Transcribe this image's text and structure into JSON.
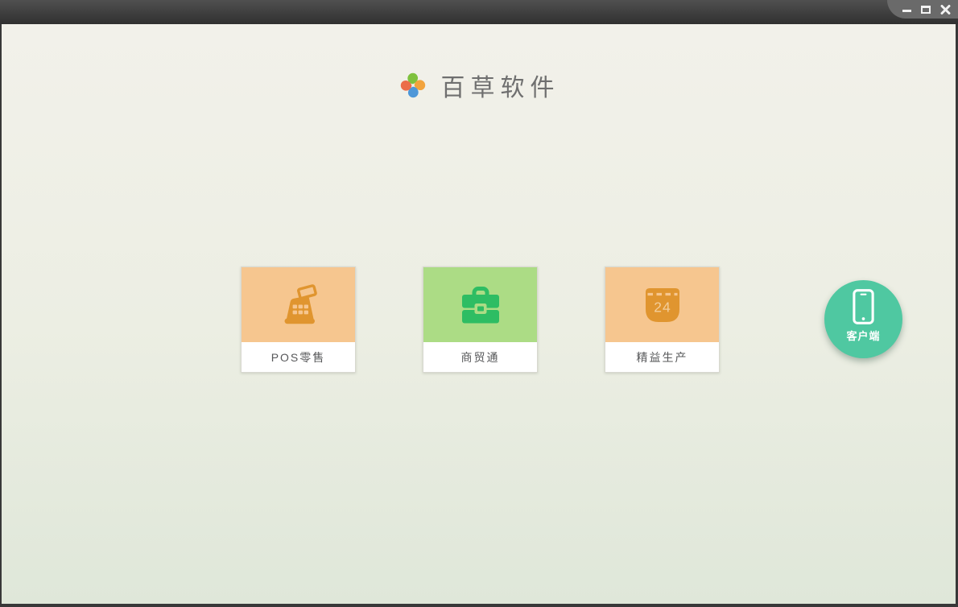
{
  "window": {
    "controls": {
      "minimize": "minimize",
      "maximize": "maximize",
      "close": "close"
    }
  },
  "brand": {
    "name": "百草软件"
  },
  "products": [
    {
      "label": "POS零售",
      "icon": "cash-register-icon"
    },
    {
      "label": "商贸通",
      "icon": "briefcase-icon"
    },
    {
      "label": "精益生产",
      "icon": "calendar-icon",
      "badge": "24"
    }
  ],
  "client": {
    "label": "客户端",
    "icon": "smartphone-icon"
  },
  "colors": {
    "orange_bg": "#F6C68F",
    "orange_icon": "#E0952F",
    "calendar_digits": "#F3CE9B",
    "green_bg": "#ACDC85",
    "green_icon": "#2EBD63",
    "teal": "#4FC8A1",
    "logo_green": "#7FC13E",
    "logo_orange": "#F2A33D",
    "logo_blue": "#4E97D8",
    "logo_red": "#EB6D4A"
  }
}
